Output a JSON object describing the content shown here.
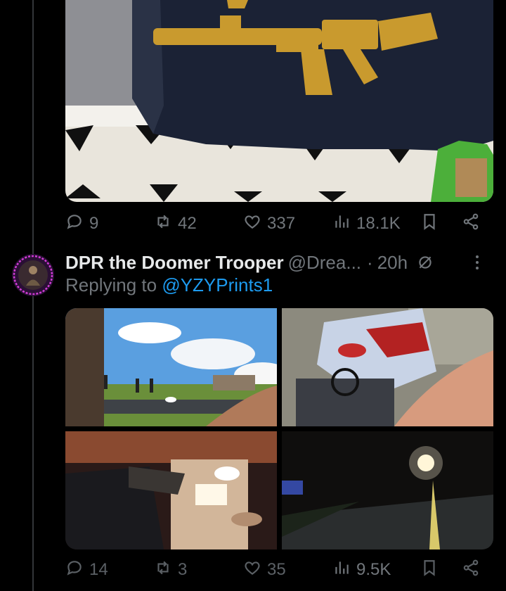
{
  "tweet1": {
    "stats": {
      "replies": "9",
      "reposts": "42",
      "likes": "337",
      "views": "18.1K"
    }
  },
  "tweet2": {
    "author": {
      "name": "DPR the Doomer Trooper",
      "handle": "@Drea...",
      "sep": "·",
      "time": "20h"
    },
    "replying_prefix": "Replying to",
    "replying_to": "@YZYPrints1",
    "stats": {
      "replies": "14",
      "reposts": "3",
      "likes": "35",
      "views": "9.5K"
    }
  },
  "colors": {
    "accent": "#1d9bf0",
    "muted": "#71767b",
    "text": "#e7e9ea",
    "background": "#000000"
  }
}
